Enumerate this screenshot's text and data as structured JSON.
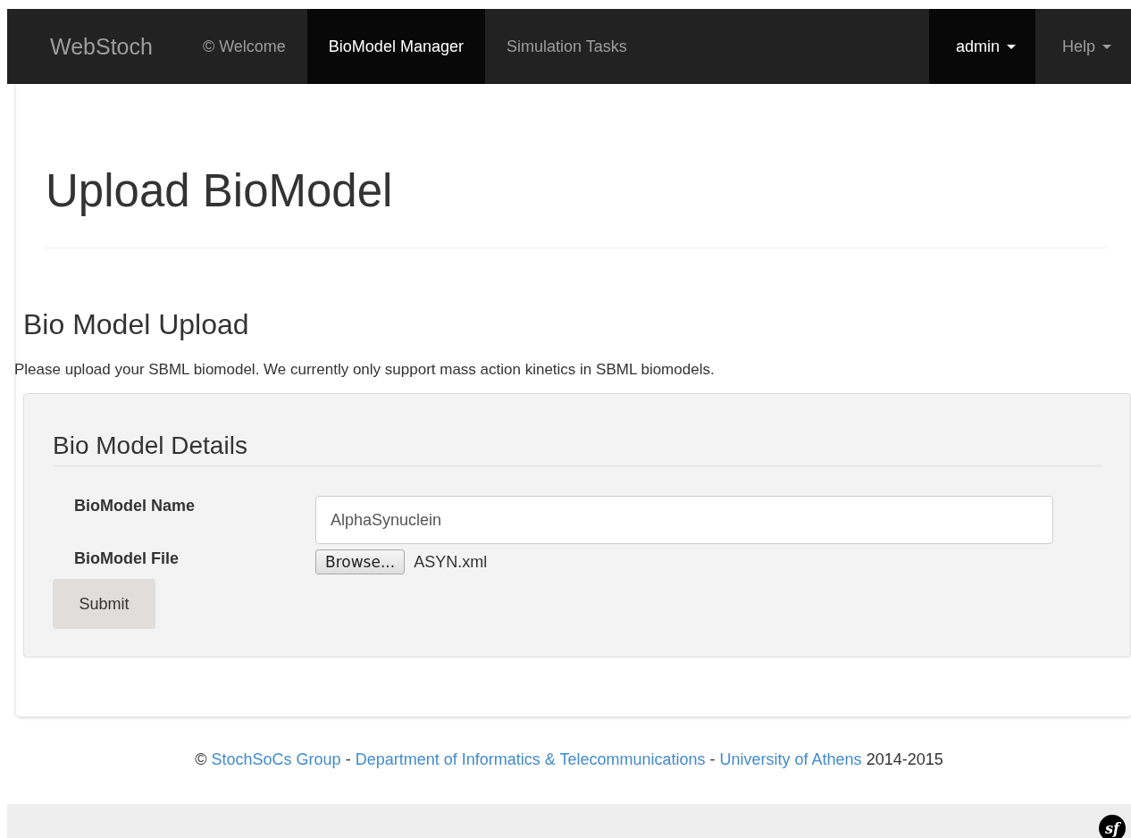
{
  "navbar": {
    "brand": "WebStoch",
    "items": [
      {
        "label": "© Welcome",
        "selected": false
      },
      {
        "label": "BioModel Manager",
        "selected": true
      },
      {
        "label": "Simulation Tasks",
        "selected": false
      }
    ],
    "right_items": [
      {
        "label": "admin",
        "selected": true
      },
      {
        "label": "Help",
        "selected": false
      }
    ]
  },
  "page_title": "Upload BioModel",
  "section_title": "Bio Model Upload",
  "description": "Please upload your SBML biomodel. We currently only support mass action kinetics in SBML biomodels.",
  "form": {
    "legend": "Bio Model Details",
    "name_label": "BioModel Name",
    "name_value": "AlphaSynuclein",
    "file_label": "BioModel File",
    "browse_button": "Browse...",
    "file_name": "ASYN.xml",
    "submit_button": "Submit"
  },
  "footer": [
    {
      "kind": "text",
      "text": "©"
    },
    {
      "kind": "link",
      "text": "StochSoCs Group"
    },
    {
      "kind": "text",
      "text": "-"
    },
    {
      "kind": "link",
      "text": "Department of Informatics & Telecommunications"
    },
    {
      "kind": "text",
      "text": "-"
    },
    {
      "kind": "link",
      "text": "University of Athens"
    },
    {
      "kind": "text",
      "text": "2014-2015"
    }
  ],
  "debug_toolbar": {
    "logo": "sf"
  }
}
